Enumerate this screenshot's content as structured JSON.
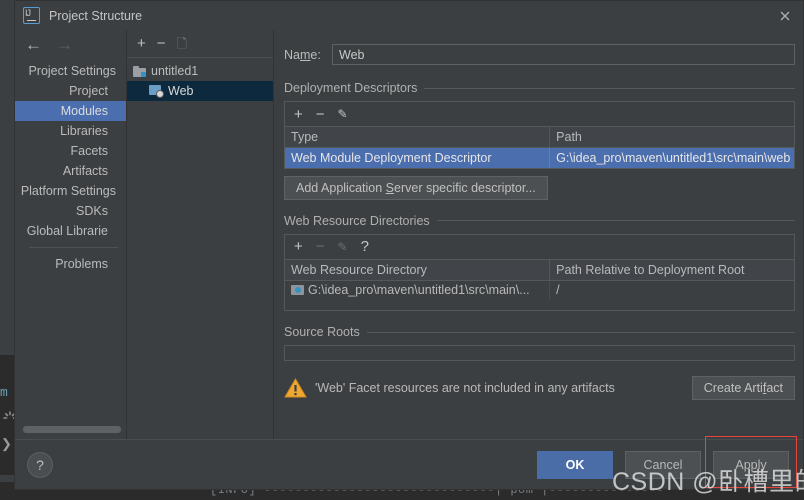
{
  "window": {
    "title": "Project Structure",
    "app_icon": "intellij-idea-icon",
    "close_icon": "close-icon"
  },
  "nav": {
    "back_icon": "arrow-left-icon",
    "forward_icon": "arrow-right-icon"
  },
  "settings_tree": {
    "items": [
      {
        "label": "Project Settings",
        "type": "group",
        "selected": false
      },
      {
        "label": "Project",
        "type": "child",
        "selected": false
      },
      {
        "label": "Modules",
        "type": "child",
        "selected": true
      },
      {
        "label": "Libraries",
        "type": "child",
        "selected": false
      },
      {
        "label": "Facets",
        "type": "child",
        "selected": false
      },
      {
        "label": "Artifacts",
        "type": "child",
        "selected": false
      },
      {
        "label": "Platform Settings",
        "type": "group",
        "selected": false
      },
      {
        "label": "SDKs",
        "type": "child",
        "selected": false
      },
      {
        "label": "Global Librarie",
        "type": "child",
        "selected": false
      }
    ],
    "after_separator": [
      {
        "label": "Problems",
        "type": "child",
        "selected": false
      }
    ]
  },
  "module_toolbar": {
    "add_icon": "plus-icon",
    "remove_icon": "minus-icon",
    "copy_icon": "copy-icon"
  },
  "module_tree": {
    "nodes": [
      {
        "label": "untitled1",
        "icon": "module-folder-icon",
        "level": 0,
        "selected": false
      },
      {
        "label": "Web",
        "icon": "web-facet-icon",
        "level": 1,
        "selected": true
      }
    ]
  },
  "form": {
    "name_label_pre": "Na",
    "name_label_mnemonic": "m",
    "name_label_post": "e:",
    "name_value": "Web"
  },
  "deployment_descriptors": {
    "title": "Deployment Descriptors",
    "toolbar": {
      "add_icon": "plus-icon",
      "remove_icon": "minus-icon",
      "edit_icon": "pencil-icon"
    },
    "columns": [
      "Type",
      "Path"
    ],
    "rows": [
      {
        "type": "Web Module Deployment Descriptor",
        "path": "G:\\idea_pro\\maven\\untitled1\\src\\main\\web",
        "selected": true
      }
    ],
    "add_button": {
      "pre": "Add Application ",
      "mnemonic": "S",
      "post": "erver specific descriptor..."
    }
  },
  "web_resource_directories": {
    "title": "Web Resource Directories",
    "toolbar": {
      "add_icon": "plus-icon",
      "remove_icon": "minus-icon",
      "edit_icon": "pencil-icon",
      "help_icon": "question-icon"
    },
    "columns": [
      "Web Resource Directory",
      "Path Relative to Deployment Root"
    ],
    "rows": [
      {
        "directory": "G:\\idea_pro\\maven\\untitled1\\src\\main\\...",
        "relative_path": "/",
        "icon": "directory-icon"
      }
    ]
  },
  "source_roots": {
    "title": "Source Roots",
    "rows": []
  },
  "warning": {
    "icon": "warning-triangle-icon",
    "message": "'Web' Facet resources are not included in any artifacts",
    "button": {
      "pre": "Create Arti",
      "mnemonic": "f",
      "post": "act"
    }
  },
  "footer": {
    "help_icon": "question-icon",
    "ok_label": "OK",
    "cancel_label": "Cancel",
    "apply_label": "Apply",
    "apply_highlight_color": "#e8443a"
  },
  "watermark": {
    "text": "CSDN @卧槽里的鸡"
  },
  "background_ide": {
    "code_fragment": "m",
    "console_text": "[INFO] ------------------------------| pom |---------------"
  },
  "colors": {
    "accent_selection": "#4b6eaf",
    "tree_selection": "#0d293e",
    "ok_button": "#4a6da7",
    "warning": "#f0a732",
    "panel_bg": "#3c3f41"
  }
}
